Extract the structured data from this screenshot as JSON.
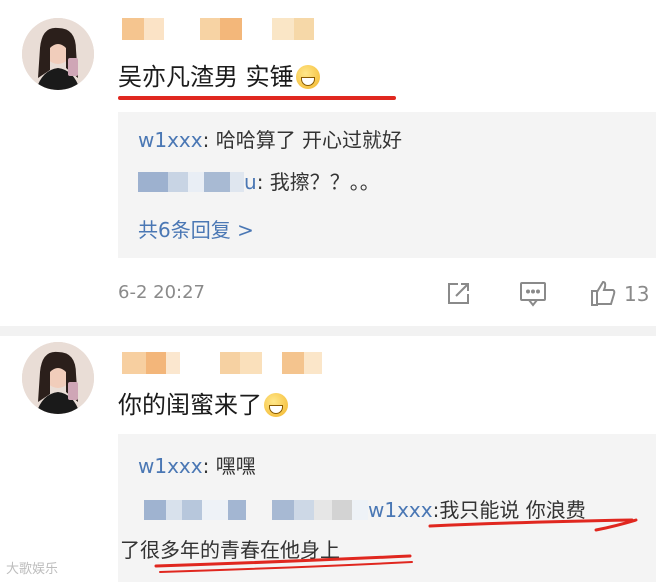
{
  "post1": {
    "content": "吴亦凡渣男 实锤",
    "replies": [
      {
        "user": "w1xxx",
        "text": ": 哈哈算了 开心过就好"
      },
      {
        "user_suffix": "u",
        "text": ": 我擦？？。。"
      }
    ],
    "more_replies": "共6条回复 >",
    "timestamp": "6-2 20:27",
    "like_count": "13"
  },
  "post2": {
    "content": "你的闺蜜来了",
    "replies": [
      {
        "user": "w1xxx",
        "text": ": 嘿嘿"
      },
      {
        "user": "w1xxx",
        "text_line1": ":我只能说 你浪费",
        "text_line2": "了很多年的青春在他身上"
      }
    ]
  },
  "watermark": "大歌娱乐",
  "colors": {
    "accent": "#4a77b4",
    "highlight": "#e0271f",
    "reply_bg": "#f4f4f4"
  },
  "icons": [
    "share-icon",
    "comment-icon",
    "like-icon",
    "laugh-emoji-icon"
  ]
}
